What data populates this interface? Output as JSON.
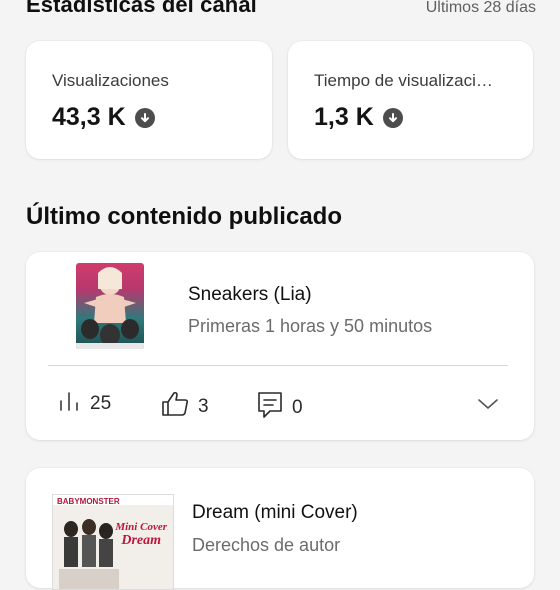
{
  "header": {
    "title": "Estadísticas del canal",
    "period": "Últimos 28 días"
  },
  "stats": [
    {
      "label": "Visualizaciones",
      "value": "43,3 K",
      "trend_icon": "arrow-down-circle-icon"
    },
    {
      "label": "Tiempo de visualizaci…",
      "value": "1,3 K",
      "trend_icon": "arrow-down-circle-icon"
    }
  ],
  "section": {
    "title": "Último contenido publicado"
  },
  "videos": [
    {
      "title": "Sneakers (Lia)",
      "subtitle": "Primeras 1 horas y 50 minutos",
      "views": "25",
      "likes": "3",
      "comments": "0"
    },
    {
      "title": "Dream (mini Cover)",
      "subtitle": "Derechos de autor",
      "thumbnail_text": {
        "brand": "BABYMONSTER",
        "line1": "Mini Cover",
        "line2": "Dream"
      }
    }
  ],
  "colors": {
    "background": "#f4f4f4",
    "card": "#ffffff",
    "icon": "#4d4d4d"
  }
}
